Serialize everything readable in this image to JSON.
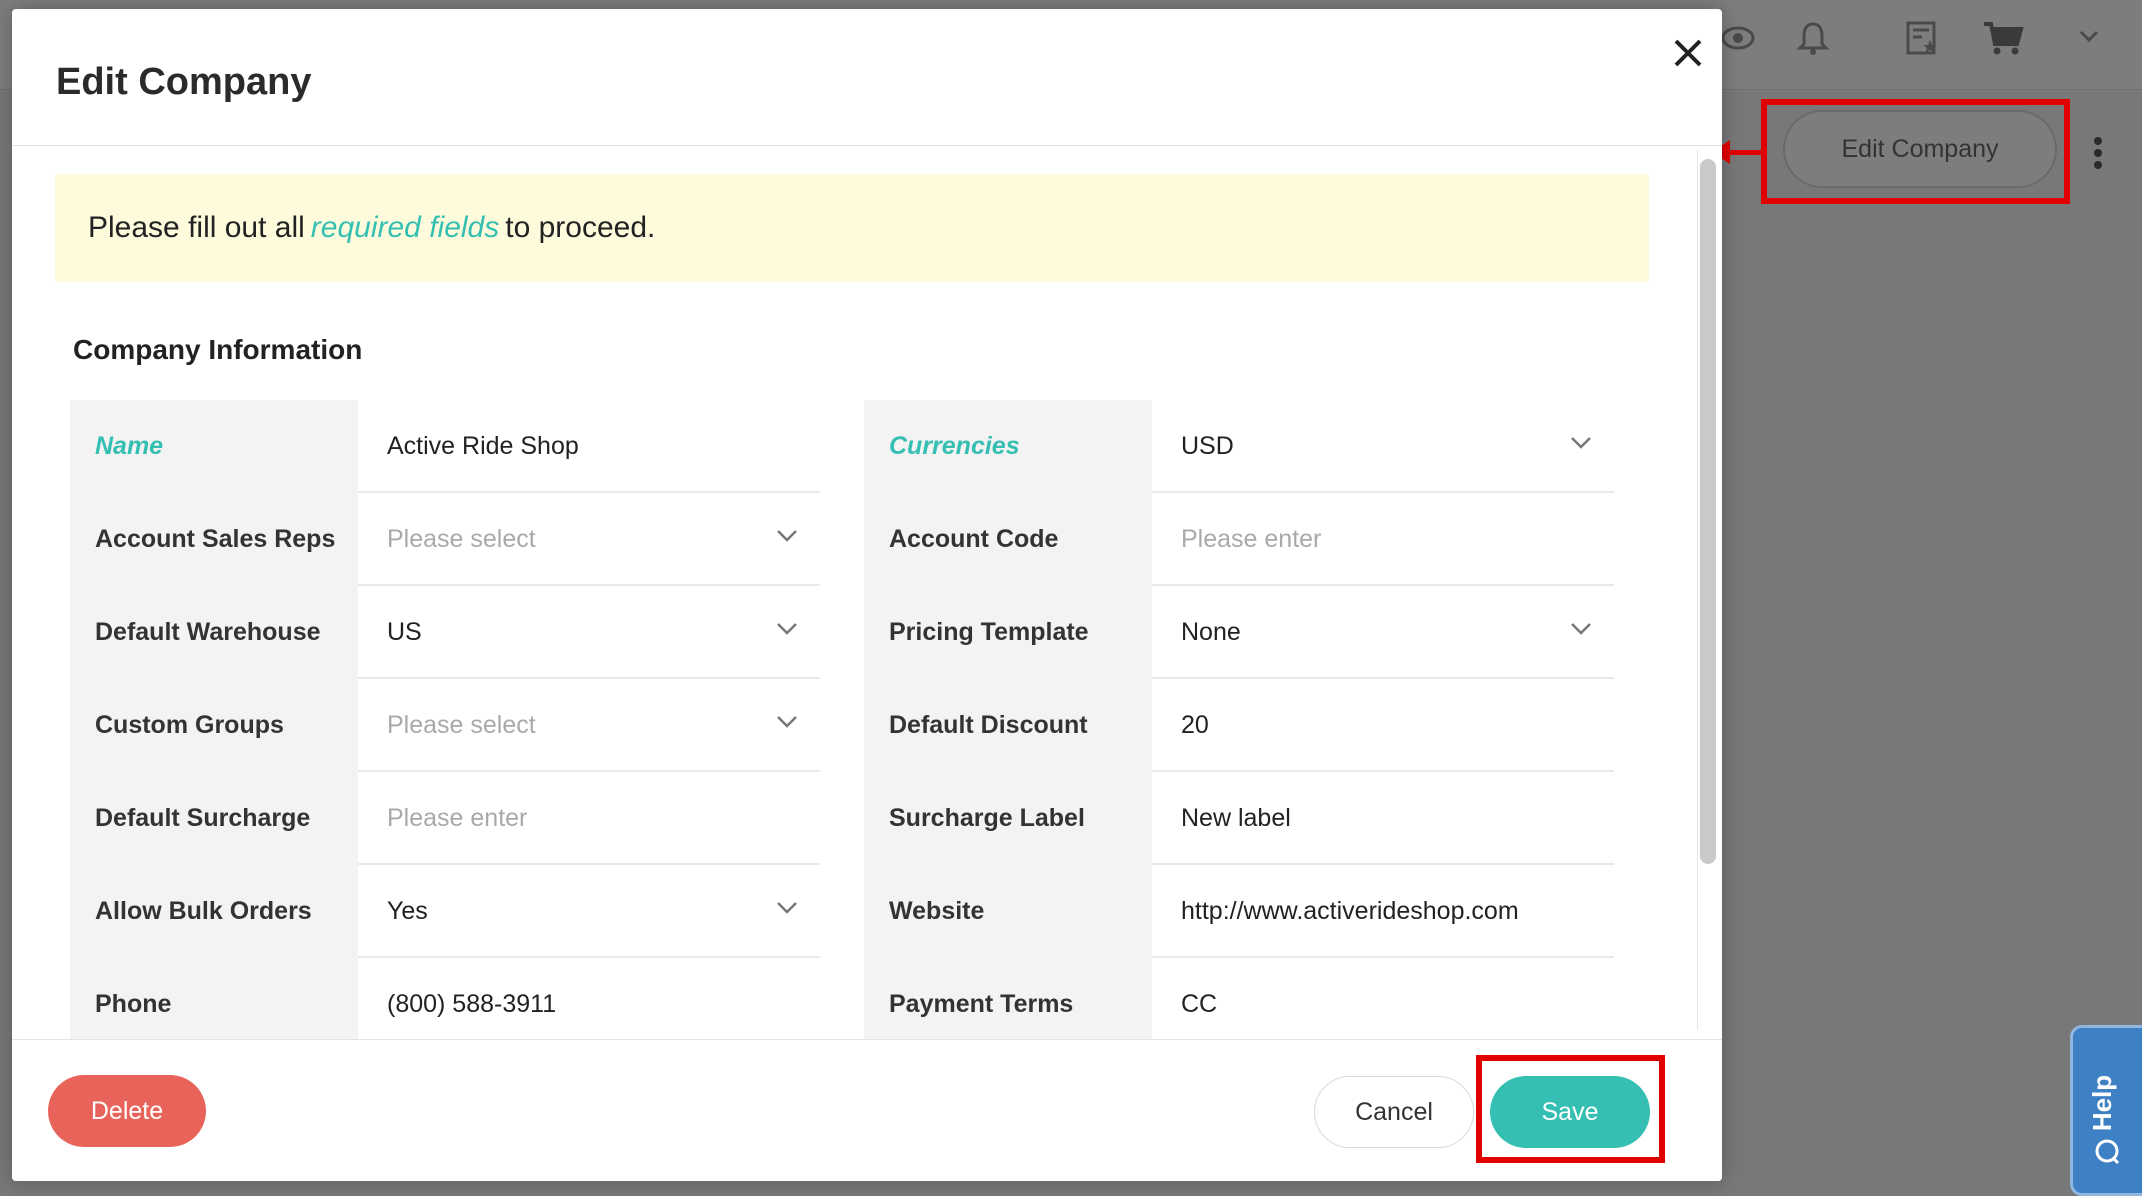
{
  "modal": {
    "title": "Edit Company",
    "notice": {
      "prefix": "Please fill out all",
      "link": "required fields",
      "suffix": "to proceed."
    },
    "section_title": "Company Information",
    "left_fields": [
      {
        "label": "Name",
        "value": "Active Ride Shop",
        "required": true,
        "placeholder": false,
        "dropdown": false
      },
      {
        "label": "Account Sales Reps",
        "value": "Please select",
        "required": false,
        "placeholder": true,
        "dropdown": true
      },
      {
        "label": "Default Warehouse",
        "value": "US",
        "required": false,
        "placeholder": false,
        "dropdown": true
      },
      {
        "label": "Custom Groups",
        "value": "Please select",
        "required": false,
        "placeholder": true,
        "dropdown": true
      },
      {
        "label": "Default Surcharge",
        "value": "Please enter",
        "required": false,
        "placeholder": true,
        "dropdown": false
      },
      {
        "label": "Allow Bulk Orders",
        "value": "Yes",
        "required": false,
        "placeholder": false,
        "dropdown": true
      },
      {
        "label": "Phone",
        "value": "(800) 588-3911",
        "required": false,
        "placeholder": false,
        "dropdown": false
      }
    ],
    "right_fields": [
      {
        "label": "Currencies",
        "value": "USD",
        "required": true,
        "placeholder": false,
        "dropdown": true
      },
      {
        "label": "Account Code",
        "value": "Please enter",
        "required": false,
        "placeholder": true,
        "dropdown": false
      },
      {
        "label": "Pricing Template",
        "value": "None",
        "required": false,
        "placeholder": false,
        "dropdown": true
      },
      {
        "label": "Default Discount",
        "value": "20",
        "required": false,
        "placeholder": false,
        "dropdown": false
      },
      {
        "label": "Surcharge Label",
        "value": "New label",
        "required": false,
        "placeholder": false,
        "dropdown": false
      },
      {
        "label": "Website",
        "value": "http://www.activerideshop.com",
        "required": false,
        "placeholder": false,
        "dropdown": false
      },
      {
        "label": "Payment Terms",
        "value": "CC",
        "required": false,
        "placeholder": false,
        "dropdown": false
      }
    ],
    "footer": {
      "delete_label": "Delete",
      "cancel_label": "Cancel",
      "save_label": "Save"
    }
  },
  "background": {
    "edit_company_label": "Edit Company",
    "help_label": "Help",
    "icons": [
      "eye-icon",
      "bell-icon",
      "catalog-icon",
      "cart-icon",
      "chevron-down-icon",
      "kebab-menu-icon"
    ]
  },
  "colors": {
    "accent": "#35bfb2",
    "danger": "#e8645b",
    "notice_bg": "#fdfbdc",
    "highlight": "#e00000",
    "help_tab": "#3d80c4"
  }
}
